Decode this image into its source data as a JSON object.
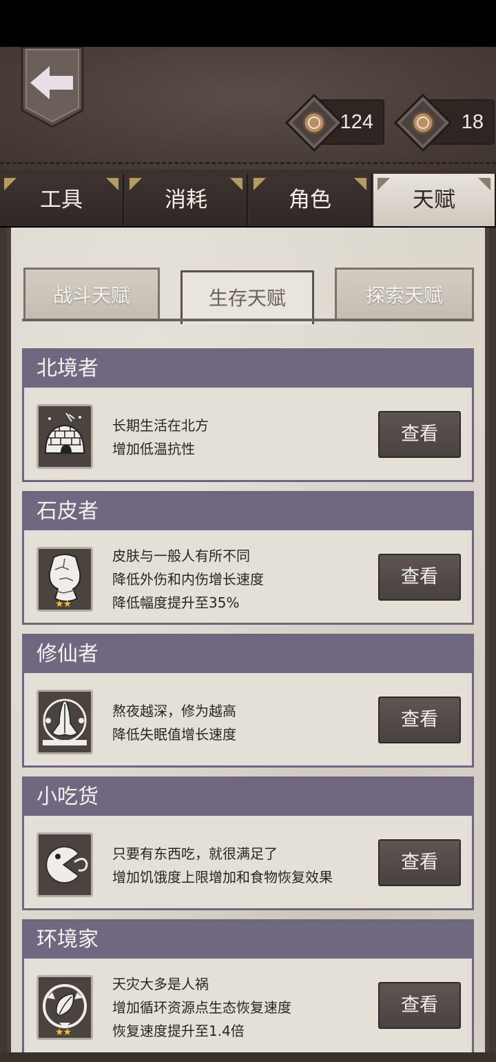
{
  "currencies": [
    {
      "icon": "coin-icon",
      "value": "124"
    },
    {
      "icon": "coin-icon",
      "value": "18"
    }
  ],
  "main_tabs": [
    {
      "label": "工具"
    },
    {
      "label": "消耗"
    },
    {
      "label": "角色"
    },
    {
      "label": "天赋",
      "active": true
    }
  ],
  "sub_tabs": [
    {
      "label": "战斗天赋"
    },
    {
      "label": "生存天赋",
      "active": true
    },
    {
      "label": "探索天赋"
    }
  ],
  "talents": [
    {
      "name": "北境者",
      "icon": "igloo-icon",
      "stars": "",
      "lines": [
        "长期生活在北方",
        "增加低温抗性"
      ],
      "button": "查看"
    },
    {
      "name": "石皮者",
      "icon": "rock-skin-icon",
      "stars": "★★",
      "lines": [
        "皮肤与一般人有所不同",
        "降低外伤和内伤增长速度",
        "降低幅度提升至35%"
      ],
      "button": "查看"
    },
    {
      "name": "修仙者",
      "icon": "praying-hands-icon",
      "stars": "",
      "lines": [
        "熬夜越深，修为越高",
        "降低失眠值增长速度"
      ],
      "button": "查看"
    },
    {
      "name": "小吃货",
      "icon": "pacman-icon",
      "stars": "",
      "lines": [
        "只要有东西吃，就很满足了",
        "增加饥饿度上限增加和食物恢复效果"
      ],
      "button": "查看"
    },
    {
      "name": "环境家",
      "icon": "recycle-leaf-icon",
      "stars": "★★",
      "lines": [
        "天灾大多是人祸",
        "增加循环资源点生态恢复速度",
        "恢复速度提升至1.4倍"
      ],
      "button": "查看"
    }
  ]
}
